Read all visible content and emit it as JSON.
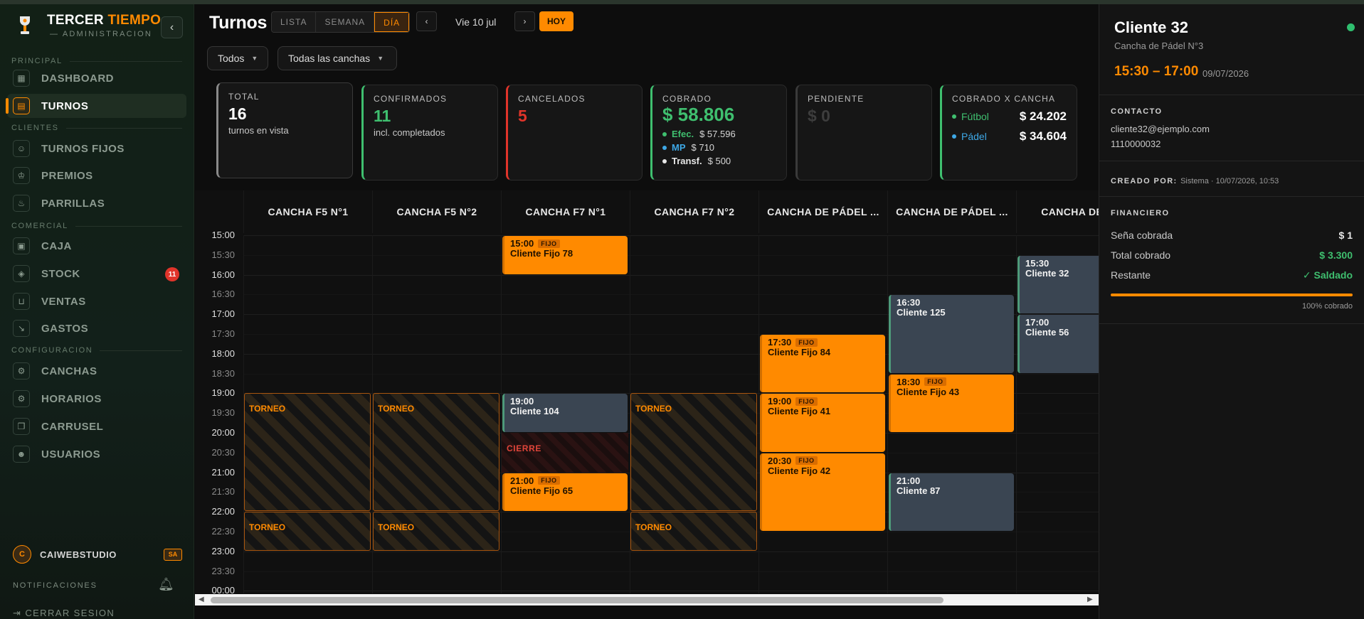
{
  "sidebar": {
    "brand_a": "TERCER",
    "brand_b": "TIEMPO",
    "brand_sub": "— ADMINISTRACION",
    "sections": [
      "PRINCIPAL",
      "CLIENTES",
      "COMERCIAL",
      "CONFIGURACION"
    ],
    "items": [
      {
        "label": "DASHBOARD",
        "icon": "grid-icon"
      },
      {
        "label": "TURNOS",
        "icon": "calendar-icon",
        "active": true
      },
      {
        "label": "TURNOS FIJOS",
        "icon": "users-icon"
      },
      {
        "label": "PREMIOS",
        "icon": "trophy-icon"
      },
      {
        "label": "PARRILLAS",
        "icon": "flame-icon"
      },
      {
        "label": "CAJA",
        "icon": "cash-register-icon"
      },
      {
        "label": "STOCK",
        "icon": "box-icon",
        "badge": "11"
      },
      {
        "label": "VENTAS",
        "icon": "cart-icon"
      },
      {
        "label": "GASTOS",
        "icon": "trend-down-icon"
      },
      {
        "label": "CANCHAS",
        "icon": "settings-icon"
      },
      {
        "label": "HORARIOS",
        "icon": "settings-icon"
      },
      {
        "label": "CARRUSEL",
        "icon": "images-icon"
      },
      {
        "label": "USUARIOS",
        "icon": "user-gear-icon"
      }
    ],
    "user": {
      "initial": "C",
      "name": "CAIWEBSTUDIO",
      "role": "SA"
    },
    "notifications_label": "NOTIFICACIONES",
    "logout_label": "CERRAR SESION"
  },
  "header": {
    "title": "Turnos",
    "view_tabs": [
      "LISTA",
      "SEMANA",
      "DÍA"
    ],
    "active_view": "DÍA",
    "prev": "‹",
    "next": "›",
    "date_label": "Vie 10 jul",
    "today_label": "HOY",
    "filters": [
      "Todos",
      "Todas las canchas"
    ]
  },
  "stats": {
    "total": {
      "title": "TOTAL",
      "value": "16",
      "sub": "turnos en vista"
    },
    "confirmados": {
      "title": "CONFIRMADOS",
      "value": "11",
      "sub": "incl. completados"
    },
    "cancelados": {
      "title": "CANCELADOS",
      "value": "5"
    },
    "cobrado": {
      "title": "COBRADO",
      "value": "$ 58.806",
      "methods": [
        {
          "label": "Efec.",
          "value": "$ 57.596",
          "color": "#3fbf6f"
        },
        {
          "label": "MP",
          "value": "$ 710",
          "color": "#3ea8e6"
        },
        {
          "label": "Transf.",
          "value": "$ 500",
          "color": "#e8e8e8"
        }
      ]
    },
    "pendiente": {
      "title": "PENDIENTE",
      "value": "$ 0"
    },
    "por_cancha": {
      "title": "COBRADO X CANCHA",
      "items": [
        {
          "label": "Fútbol",
          "value": "$ 24.202",
          "color": "#3fbf6f"
        },
        {
          "label": "Pádel",
          "value": "$ 34.604",
          "color": "#3ea8e6"
        }
      ]
    }
  },
  "calendar": {
    "courts": [
      "CANCHA F5 N°1",
      "CANCHA F5 N°2",
      "CANCHA F7 N°1",
      "CANCHA F7 N°2",
      "CANCHA DE PÁDEL ...",
      "CANCHA DE PÁDEL ...",
      "CANCHA DE PÁ"
    ],
    "times": [
      "15:00",
      "15:30",
      "16:00",
      "16:30",
      "17:00",
      "17:30",
      "18:00",
      "18:30",
      "19:00",
      "19:30",
      "20:00",
      "20:30",
      "21:00",
      "21:30",
      "22:00",
      "22:30",
      "23:00",
      "23:30",
      "00:00"
    ],
    "fijo_tag": "FIJO",
    "events": [
      {
        "col": 2,
        "start": 0,
        "dur": 2,
        "time": "15:00",
        "name": "Cliente Fijo 78",
        "kind": "fijo"
      },
      {
        "col": 2,
        "start": 8,
        "dur": 2,
        "time": "19:00",
        "name": "Cliente 104",
        "kind": "cliente"
      },
      {
        "col": 2,
        "start": 12,
        "dur": 2,
        "time": "21:00",
        "name": "Cliente Fijo 65",
        "kind": "fijo"
      },
      {
        "col": 4,
        "start": 5,
        "dur": 3,
        "time": "17:30",
        "name": "Cliente Fijo 84",
        "kind": "fijo"
      },
      {
        "col": 4,
        "start": 8,
        "dur": 3,
        "time": "19:00",
        "name": "Cliente Fijo 41",
        "kind": "fijo"
      },
      {
        "col": 4,
        "start": 11,
        "dur": 4,
        "time": "20:30",
        "name": "Cliente Fijo 42",
        "kind": "fijo"
      },
      {
        "col": 5,
        "start": 3,
        "dur": 4,
        "time": "16:30",
        "name": "Cliente 125",
        "kind": "cliente"
      },
      {
        "col": 5,
        "start": 7,
        "dur": 3,
        "time": "18:30",
        "name": "Cliente Fijo 43",
        "kind": "fijo"
      },
      {
        "col": 5,
        "start": 12,
        "dur": 3,
        "time": "21:00",
        "name": "Cliente 87",
        "kind": "cliente"
      },
      {
        "col": 6,
        "start": 1,
        "dur": 3,
        "time": "15:30",
        "name": "Cliente 32",
        "kind": "cliente"
      },
      {
        "col": 6,
        "start": 4,
        "dur": 3,
        "time": "17:00",
        "name": "Cliente 56",
        "kind": "cliente"
      }
    ],
    "blocks": [
      {
        "col": 0,
        "start": 8,
        "dur": 6,
        "label": "TORNEO"
      },
      {
        "col": 1,
        "start": 8,
        "dur": 6,
        "label": "TORNEO"
      },
      {
        "col": 3,
        "start": 8,
        "dur": 6,
        "label": "TORNEO"
      },
      {
        "col": 0,
        "start": 14,
        "dur": 2,
        "label": "TORNEO"
      },
      {
        "col": 1,
        "start": 14,
        "dur": 2,
        "label": "TORNEO"
      },
      {
        "col": 3,
        "start": 14,
        "dur": 2,
        "label": "TORNEO"
      }
    ],
    "closures": [
      {
        "col": 2,
        "start": 10,
        "dur": 2,
        "label": "CIERRE"
      }
    ]
  },
  "detail": {
    "title": "Cliente 32",
    "court": "Cancha de Pádel N°3",
    "time": "15:30 – 17:00",
    "date": "09/07/2026",
    "contact_title": "CONTACTO",
    "email": "cliente32@ejemplo.com",
    "phone": "1110000032",
    "created_title": "CREADO POR:",
    "created_value": "Sistema · 10/07/2026, 10:53",
    "fin_title": "FINANCIERO",
    "sena_label": "Seña cobrada",
    "sena_value": "$ 1",
    "total_label": "Total cobrado",
    "total_value": "$ 3.300",
    "rest_label": "Restante",
    "rest_value": "✓ Saldado",
    "progress": 1.0,
    "progress_label": "100% cobrado"
  }
}
